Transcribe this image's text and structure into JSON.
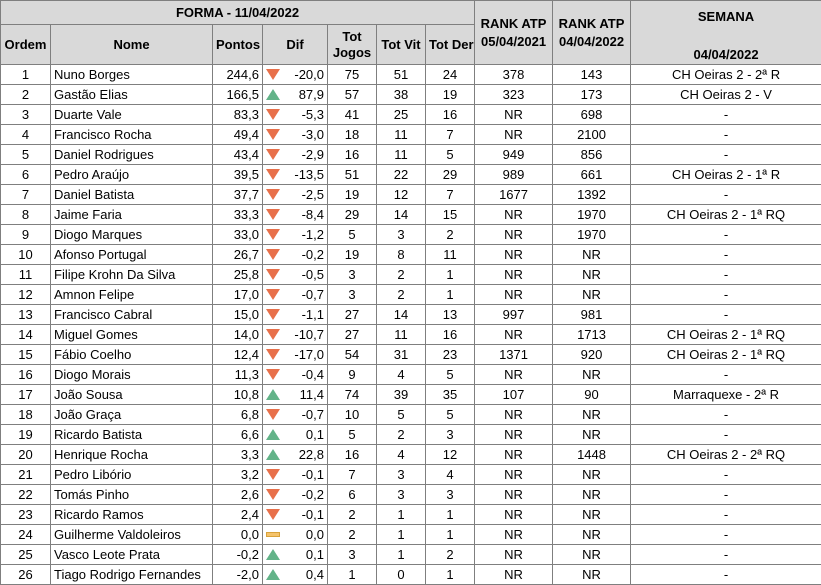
{
  "colors": {
    "header_bg": "#d9d9d9",
    "down": "#e8704a",
    "up": "#63b389",
    "flat": "#f5c36b",
    "grid": "#7f7f7f"
  },
  "header": {
    "forma_title": "FORMA - 11/04/2022",
    "ordem": "Ordem",
    "nome": "Nome",
    "pontos": "Pontos",
    "dif": "Dif",
    "tot_jogos": "Tot Jogos",
    "tot_vit": "Tot Vit",
    "tot_der": "Tot Der",
    "rank_a_line1": "RANK ATP",
    "rank_a_line2": "05/04/2021",
    "rank_b_line1": "RANK ATP",
    "rank_b_line2": "04/04/2022",
    "semana": "SEMANA",
    "semana_date": "04/04/2022"
  },
  "rows": [
    {
      "ordem": "1",
      "nome": "Nuno Borges",
      "pontos": "244,6",
      "trend": "down",
      "dif": "-20,0",
      "jogos": "75",
      "vit": "51",
      "der": "24",
      "rank2021": "378",
      "rank2022": "143",
      "semana": "CH Oeiras 2 - 2ª R"
    },
    {
      "ordem": "2",
      "nome": "Gastão Elias",
      "pontos": "166,5",
      "trend": "up",
      "dif": "87,9",
      "jogos": "57",
      "vit": "38",
      "der": "19",
      "rank2021": "323",
      "rank2022": "173",
      "semana": "CH Oeiras 2 - V"
    },
    {
      "ordem": "3",
      "nome": "Duarte Vale",
      "pontos": "83,3",
      "trend": "down",
      "dif": "-5,3",
      "jogos": "41",
      "vit": "25",
      "der": "16",
      "rank2021": "NR",
      "rank2022": "698",
      "semana": "-"
    },
    {
      "ordem": "4",
      "nome": "Francisco Rocha",
      "pontos": "49,4",
      "trend": "down",
      "dif": "-3,0",
      "jogos": "18",
      "vit": "11",
      "der": "7",
      "rank2021": "NR",
      "rank2022": "2100",
      "semana": "-"
    },
    {
      "ordem": "5",
      "nome": "Daniel Rodrigues",
      "pontos": "43,4",
      "trend": "down",
      "dif": "-2,9",
      "jogos": "16",
      "vit": "11",
      "der": "5",
      "rank2021": "949",
      "rank2022": "856",
      "semana": "-"
    },
    {
      "ordem": "6",
      "nome": "Pedro Araújo",
      "pontos": "39,5",
      "trend": "down",
      "dif": "-13,5",
      "jogos": "51",
      "vit": "22",
      "der": "29",
      "rank2021": "989",
      "rank2022": "661",
      "semana": "CH Oeiras 2 - 1ª R"
    },
    {
      "ordem": "7",
      "nome": "Daniel Batista",
      "pontos": "37,7",
      "trend": "down",
      "dif": "-2,5",
      "jogos": "19",
      "vit": "12",
      "der": "7",
      "rank2021": "1677",
      "rank2022": "1392",
      "semana": "-"
    },
    {
      "ordem": "8",
      "nome": "Jaime Faria",
      "pontos": "33,3",
      "trend": "down",
      "dif": "-8,4",
      "jogos": "29",
      "vit": "14",
      "der": "15",
      "rank2021": "NR",
      "rank2022": "1970",
      "semana": "CH Oeiras 2 - 1ª RQ"
    },
    {
      "ordem": "9",
      "nome": "Diogo Marques",
      "pontos": "33,0",
      "trend": "down",
      "dif": "-1,2",
      "jogos": "5",
      "vit": "3",
      "der": "2",
      "rank2021": "NR",
      "rank2022": "1970",
      "semana": "-"
    },
    {
      "ordem": "10",
      "nome": "Afonso Portugal",
      "pontos": "26,7",
      "trend": "down",
      "dif": "-0,2",
      "jogos": "19",
      "vit": "8",
      "der": "11",
      "rank2021": "NR",
      "rank2022": "NR",
      "semana": "-"
    },
    {
      "ordem": "11",
      "nome": "Filipe Krohn Da Silva",
      "pontos": "25,8",
      "trend": "down",
      "dif": "-0,5",
      "jogos": "3",
      "vit": "2",
      "der": "1",
      "rank2021": "NR",
      "rank2022": "NR",
      "semana": "-"
    },
    {
      "ordem": "12",
      "nome": "Amnon Felipe",
      "pontos": "17,0",
      "trend": "down",
      "dif": "-0,7",
      "jogos": "3",
      "vit": "2",
      "der": "1",
      "rank2021": "NR",
      "rank2022": "NR",
      "semana": "-"
    },
    {
      "ordem": "13",
      "nome": "Francisco Cabral",
      "pontos": "15,0",
      "trend": "down",
      "dif": "-1,1",
      "jogos": "27",
      "vit": "14",
      "der": "13",
      "rank2021": "997",
      "rank2022": "981",
      "semana": "-"
    },
    {
      "ordem": "14",
      "nome": "Miguel Gomes",
      "pontos": "14,0",
      "trend": "down",
      "dif": "-10,7",
      "jogos": "27",
      "vit": "11",
      "der": "16",
      "rank2021": "NR",
      "rank2022": "1713",
      "semana": "CH Oeiras 2 - 1ª RQ"
    },
    {
      "ordem": "15",
      "nome": "Fábio Coelho",
      "pontos": "12,4",
      "trend": "down",
      "dif": "-17,0",
      "jogos": "54",
      "vit": "31",
      "der": "23",
      "rank2021": "1371",
      "rank2022": "920",
      "semana": "CH Oeiras 2 - 1ª RQ"
    },
    {
      "ordem": "16",
      "nome": "Diogo Morais",
      "pontos": "11,3",
      "trend": "down",
      "dif": "-0,4",
      "jogos": "9",
      "vit": "4",
      "der": "5",
      "rank2021": "NR",
      "rank2022": "NR",
      "semana": "-"
    },
    {
      "ordem": "17",
      "nome": "João Sousa",
      "pontos": "10,8",
      "trend": "up",
      "dif": "11,4",
      "jogos": "74",
      "vit": "39",
      "der": "35",
      "rank2021": "107",
      "rank2022": "90",
      "semana": "Marraquexe - 2ª R"
    },
    {
      "ordem": "18",
      "nome": "João Graça",
      "pontos": "6,8",
      "trend": "down",
      "dif": "-0,7",
      "jogos": "10",
      "vit": "5",
      "der": "5",
      "rank2021": "NR",
      "rank2022": "NR",
      "semana": "-"
    },
    {
      "ordem": "19",
      "nome": "Ricardo Batista",
      "pontos": "6,6",
      "trend": "up",
      "dif": "0,1",
      "jogos": "5",
      "vit": "2",
      "der": "3",
      "rank2021": "NR",
      "rank2022": "NR",
      "semana": "-"
    },
    {
      "ordem": "20",
      "nome": "Henrique Rocha",
      "pontos": "3,3",
      "trend": "up",
      "dif": "22,8",
      "jogos": "16",
      "vit": "4",
      "der": "12",
      "rank2021": "NR",
      "rank2022": "1448",
      "semana": "CH Oeiras 2 - 2ª RQ"
    },
    {
      "ordem": "21",
      "nome": "Pedro Libório",
      "pontos": "3,2",
      "trend": "down",
      "dif": "-0,1",
      "jogos": "7",
      "vit": "3",
      "der": "4",
      "rank2021": "NR",
      "rank2022": "NR",
      "semana": "-"
    },
    {
      "ordem": "22",
      "nome": "Tomás Pinho",
      "pontos": "2,6",
      "trend": "down",
      "dif": "-0,2",
      "jogos": "6",
      "vit": "3",
      "der": "3",
      "rank2021": "NR",
      "rank2022": "NR",
      "semana": "-"
    },
    {
      "ordem": "23",
      "nome": "Ricardo Ramos",
      "pontos": "2,4",
      "trend": "down",
      "dif": "-0,1",
      "jogos": "2",
      "vit": "1",
      "der": "1",
      "rank2021": "NR",
      "rank2022": "NR",
      "semana": "-"
    },
    {
      "ordem": "24",
      "nome": "Guilherme Valdoleiros",
      "pontos": "0,0",
      "trend": "flat",
      "dif": "0,0",
      "jogos": "2",
      "vit": "1",
      "der": "1",
      "rank2021": "NR",
      "rank2022": "NR",
      "semana": "-"
    },
    {
      "ordem": "25",
      "nome": "Vasco Leote Prata",
      "pontos": "-0,2",
      "trend": "up",
      "dif": "0,1",
      "jogos": "3",
      "vit": "1",
      "der": "2",
      "rank2021": "NR",
      "rank2022": "NR",
      "semana": "-"
    },
    {
      "ordem": "26",
      "nome": "Tiago Rodrigo Fernandes",
      "pontos": "-2,0",
      "trend": "up",
      "dif": "0,4",
      "jogos": "1",
      "vit": "0",
      "der": "1",
      "rank2021": "NR",
      "rank2022": "NR",
      "semana": "-"
    }
  ]
}
